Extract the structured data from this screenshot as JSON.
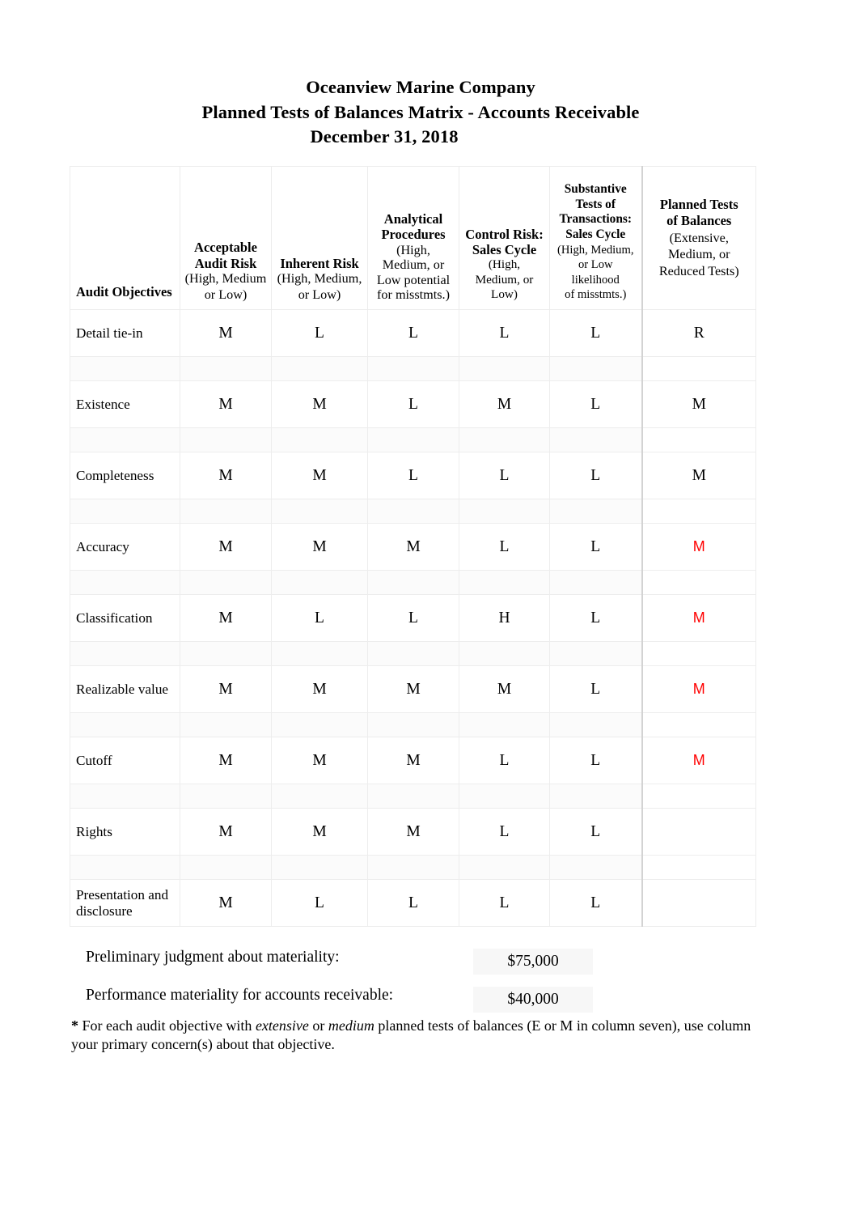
{
  "document": {
    "title_lines": [
      "Oceanview Marine Company",
      "Planned Tests of Balances Matrix - Accounts Receivable",
      "December 31, 2018"
    ]
  },
  "matrix": {
    "columns": [
      {
        "key": "audit_objectives",
        "bold": "Audit Objectives",
        "note": ""
      },
      {
        "key": "acceptable_audit_risk",
        "bold": "Acceptable\nAudit Risk",
        "bold_l1": "Acceptable",
        "bold_l2": "Audit Risk",
        "note": "(High, Medium\nor Low)",
        "note_l1": "(High, Medium",
        "note_l2": "or Low)"
      },
      {
        "key": "inherent_risk",
        "bold_l1": "Inherent Risk",
        "note_l1": "(High, Medium,",
        "note_l2": "or Low)"
      },
      {
        "key": "analytical_procedures",
        "bold_l1": "Analytical",
        "bold_l2": "Procedures",
        "note_l1": "(High,",
        "note_l2": "Medium, or",
        "note_l3": "Low potential",
        "note_l4": "for misstmts.)"
      },
      {
        "key": "control_risk_sales_cycle",
        "bold_l1": "Control Risk:",
        "bold_l2": "Sales Cycle",
        "note_l1": "(High,",
        "note_l2": "Medium, or",
        "note_l3": "Low)"
      },
      {
        "key": "substantive_tests_transactions",
        "bold_l1": "Substantive",
        "bold_l2": "Tests of",
        "bold_l3": "Transactions:",
        "bold_l4": "Sales Cycle",
        "note_l1": "(High, Medium,",
        "note_l2": "or Low likelihood",
        "note_l3": "of misstmts.)"
      },
      {
        "key": "planned_tests_of_balances",
        "bold_l1": "Planned Tests",
        "bold_l2": "of Balances",
        "note_l1": "(Extensive,",
        "note_l2": "Medium, or",
        "note_l3": "Reduced Tests)"
      }
    ],
    "rows": [
      {
        "objective": "Detail tie-in",
        "acceptable_audit_risk": "M",
        "inherent_risk": "L",
        "analytical_procedures": "L",
        "control_risk": "L",
        "substantive_tests": "L",
        "planned_tests": "R",
        "planned_tests_red": false
      },
      {
        "objective": "Existence",
        "acceptable_audit_risk": "M",
        "inherent_risk": "M",
        "analytical_procedures": "L",
        "control_risk": "M",
        "substantive_tests": "L",
        "planned_tests": "M",
        "planned_tests_red": false
      },
      {
        "objective": "Completeness",
        "acceptable_audit_risk": "M",
        "inherent_risk": "M",
        "analytical_procedures": "L",
        "control_risk": "L",
        "substantive_tests": "L",
        "planned_tests": "M",
        "planned_tests_red": false
      },
      {
        "objective": "Accuracy",
        "acceptable_audit_risk": "M",
        "inherent_risk": "M",
        "analytical_procedures": "M",
        "control_risk": "L",
        "substantive_tests": "L",
        "planned_tests": "M",
        "planned_tests_red": true
      },
      {
        "objective": "Classification",
        "acceptable_audit_risk": "M",
        "inherent_risk": "L",
        "analytical_procedures": "L",
        "control_risk": "H",
        "substantive_tests": "L",
        "planned_tests": "M",
        "planned_tests_red": true
      },
      {
        "objective": "Realizable value",
        "acceptable_audit_risk": "M",
        "inherent_risk": "M",
        "analytical_procedures": "M",
        "control_risk": "M",
        "substantive_tests": "L",
        "planned_tests": "M",
        "planned_tests_red": true
      },
      {
        "objective": "Cutoff",
        "acceptable_audit_risk": "M",
        "inherent_risk": "M",
        "analytical_procedures": "M",
        "control_risk": "L",
        "substantive_tests": "L",
        "planned_tests": "M",
        "planned_tests_red": true
      },
      {
        "objective": "Rights",
        "acceptable_audit_risk": "M",
        "inherent_risk": "M",
        "analytical_procedures": "M",
        "control_risk": "L",
        "substantive_tests": "L",
        "planned_tests": "",
        "planned_tests_red": false
      },
      {
        "objective": "Presentation and disclosure",
        "acceptable_audit_risk": "M",
        "inherent_risk": "L",
        "analytical_procedures": "L",
        "control_risk": "L",
        "substantive_tests": "L",
        "planned_tests": "",
        "planned_tests_red": false
      }
    ]
  },
  "materiality": {
    "preliminary_label": "Preliminary judgment about materiality:",
    "preliminary_value": "$75,000",
    "performance_label": "Performance materiality for accounts receivable:",
    "performance_value": "$40,000"
  },
  "footnote": {
    "star": "*",
    "part1": " For each audit objective with ",
    "em1": "extensive",
    "part2": " or ",
    "em2": "medium",
    "part3": " planned tests of balances (E or M in column seven), use column your primary concern(s) about that objective."
  },
  "colors": {
    "red_accent": "#ff0000",
    "grid_line": "#ededed",
    "heavy_divider": "#d3d3d3",
    "text": "#000000"
  }
}
